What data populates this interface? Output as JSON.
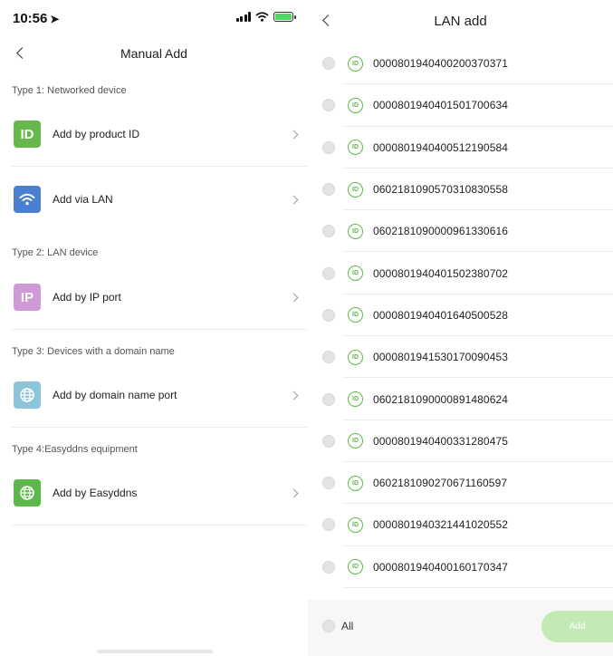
{
  "status": {
    "time": "10:56"
  },
  "manual": {
    "title": "Manual Add",
    "sections": [
      {
        "header": "Type 1: Networked device"
      },
      {
        "header": "Type 2: LAN device"
      },
      {
        "header": "Type 3: Devices with a domain name"
      },
      {
        "header": "Type 4:Easyddns equipment"
      }
    ],
    "items": [
      {
        "label": "Add by product ID",
        "icon": "id-icon",
        "glyph": "ID",
        "color": "#67b84a"
      },
      {
        "label": "Add via LAN",
        "icon": "wifi-icon",
        "color": "#4a7fd1"
      },
      {
        "label": "Add by IP port",
        "icon": "ip-icon",
        "glyph": "IP",
        "color": "#cf9ad8"
      },
      {
        "label": "Add by domain name port",
        "icon": "globe-icon",
        "color": "#8cc5d9"
      },
      {
        "label": "Add by Easyddns",
        "icon": "globe-icon",
        "color": "#5bb84a"
      }
    ]
  },
  "lan": {
    "title": "LAN add",
    "badge": "ID",
    "devices": [
      "000080194040020037037​1",
      "0000801940401501700634",
      "0000801940400512190584",
      "0602181090570310830558",
      "0602181090000961330616",
      "0000801940401502380702",
      "0000801940401640500528",
      "0000801941530170090453",
      "0602181090000891480624",
      "0000801940400331280475",
      "0602181090270671160597",
      "0000801940321441020552",
      "0000801940400160170347"
    ],
    "all_label": "All",
    "add_label": "Add"
  },
  "colors": {
    "accent": "#5fb94a",
    "add_button": "#c3eab5"
  }
}
